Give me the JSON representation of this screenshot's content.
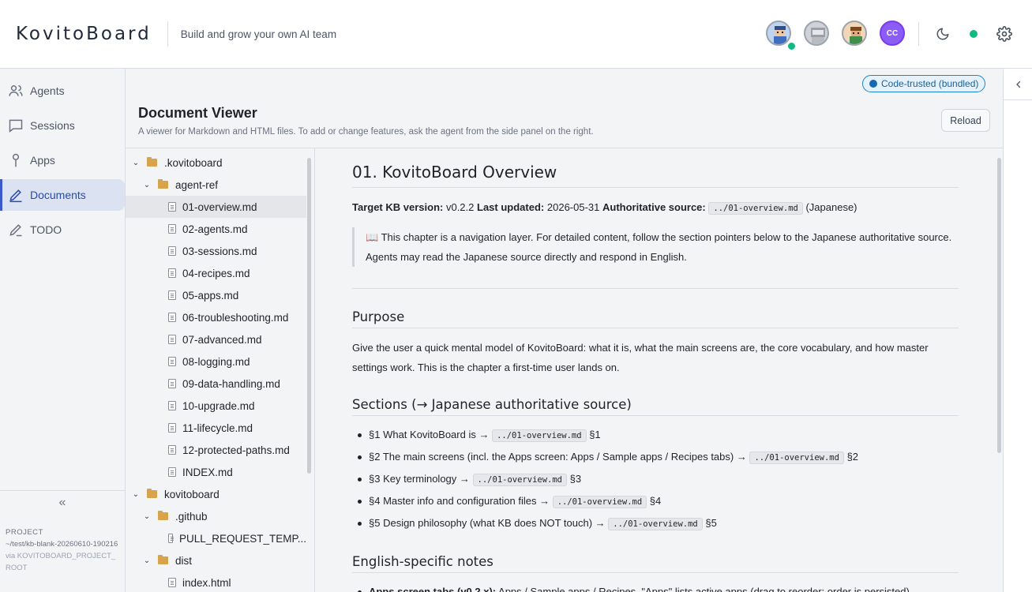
{
  "app": {
    "brand": "KovitoBoard",
    "tagline": "Build and grow your own AI team"
  },
  "header": {
    "avatars": [
      {
        "name": "agent-avatar-1",
        "label": ""
      },
      {
        "name": "agent-avatar-2",
        "label": ""
      },
      {
        "name": "agent-avatar-3",
        "label": ""
      },
      {
        "name": "user-avatar",
        "label": "CC"
      }
    ],
    "icons": [
      "moon-icon",
      "status-dot",
      "gear-icon"
    ]
  },
  "sidebar": {
    "items": [
      {
        "label": "Agents",
        "icon": "users-icon",
        "active": false
      },
      {
        "label": "Sessions",
        "icon": "chat-icon",
        "active": false
      },
      {
        "label": "Apps",
        "icon": "pin-icon",
        "active": false
      },
      {
        "label": "Documents",
        "icon": "pen-icon",
        "active": true
      },
      {
        "label": "TODO",
        "icon": "pencil-icon",
        "active": false
      }
    ],
    "collapse_label": "«",
    "project": {
      "label": "PROJECT",
      "path": "~/test/kb-blank-20260610-190216",
      "via": "via KOVITOBOARD_PROJECT_ROOT"
    }
  },
  "main": {
    "trust_badge": "Code-trusted (bundled)",
    "title": "Document Viewer",
    "description": "A viewer for Markdown and HTML files. To add or change features, ask the agent from the side panel on the right.",
    "reload_label": "Reload"
  },
  "tree": [
    {
      "label": ".kovitoboard",
      "type": "folder",
      "depth": 0,
      "selected": false
    },
    {
      "label": "agent-ref",
      "type": "folder",
      "depth": 1,
      "selected": false
    },
    {
      "label": "01-overview.md",
      "type": "file",
      "depth": 2,
      "selected": true
    },
    {
      "label": "02-agents.md",
      "type": "file",
      "depth": 2,
      "selected": false
    },
    {
      "label": "03-sessions.md",
      "type": "file",
      "depth": 2,
      "selected": false
    },
    {
      "label": "04-recipes.md",
      "type": "file",
      "depth": 2,
      "selected": false
    },
    {
      "label": "05-apps.md",
      "type": "file",
      "depth": 2,
      "selected": false
    },
    {
      "label": "06-troubleshooting.md",
      "type": "file",
      "depth": 2,
      "selected": false
    },
    {
      "label": "07-advanced.md",
      "type": "file",
      "depth": 2,
      "selected": false
    },
    {
      "label": "08-logging.md",
      "type": "file",
      "depth": 2,
      "selected": false
    },
    {
      "label": "09-data-handling.md",
      "type": "file",
      "depth": 2,
      "selected": false
    },
    {
      "label": "10-upgrade.md",
      "type": "file",
      "depth": 2,
      "selected": false
    },
    {
      "label": "11-lifecycle.md",
      "type": "file",
      "depth": 2,
      "selected": false
    },
    {
      "label": "12-protected-paths.md",
      "type": "file",
      "depth": 2,
      "selected": false
    },
    {
      "label": "INDEX.md",
      "type": "file",
      "depth": 2,
      "selected": false
    },
    {
      "label": "kovitoboard",
      "type": "folder",
      "depth": 0,
      "selected": false
    },
    {
      "label": ".github",
      "type": "folder",
      "depth": 1,
      "selected": false
    },
    {
      "label": "PULL_REQUEST_TEMP...",
      "type": "file",
      "depth": 2,
      "selected": false
    },
    {
      "label": "dist",
      "type": "folder",
      "depth": 1,
      "selected": false
    },
    {
      "label": "index.html",
      "type": "file",
      "depth": 2,
      "selected": false
    }
  ],
  "doc": {
    "title": "01. KovitoBoard Overview",
    "meta": {
      "version_label": "Target KB version:",
      "version": "v0.2.2",
      "updated_label": "Last updated:",
      "updated": "2026-05-31",
      "source_label": "Authoritative source:",
      "source_code": "../01-overview.md",
      "source_lang": "(Japanese)"
    },
    "quote_icon": "📖",
    "quote": "This chapter is a navigation layer. For detailed content, follow the section pointers below to the Japanese authoritative source. Agents may read the Japanese source directly and respond in English.",
    "purpose_heading": "Purpose",
    "purpose_text": "Give the user a quick mental model of KovitoBoard: what it is, what the main screens are, the core vocabulary, and how master settings work. This is the chapter a first-time user lands on.",
    "sections_heading": "Sections (→ Japanese authoritative source)",
    "sections": [
      {
        "text": "§1 What KovitoBoard is →",
        "code": "../01-overview.md",
        "suffix": "§1"
      },
      {
        "text": "§2 The main screens (incl. the Apps screen: Apps / Sample apps / Recipes tabs) →",
        "code": "../01-overview.md",
        "suffix": "§2"
      },
      {
        "text": "§3 Key terminology →",
        "code": "../01-overview.md",
        "suffix": "§3"
      },
      {
        "text": "§4 Master info and configuration files →",
        "code": "../01-overview.md",
        "suffix": "§4"
      },
      {
        "text": "§5 Design philosophy (what KB does NOT touch) →",
        "code": "../01-overview.md",
        "suffix": "§5"
      }
    ],
    "english_heading": "English-specific notes",
    "english_notes": [
      {
        "bold": "Apps screen tabs (v0.2.x):",
        "text": " Apps / Sample apps / Recipes. \"Apps\" lists active apps (drag to reorder; order is persisted)."
      }
    ]
  },
  "right_panel": {
    "toggle_icon": "chevron-left-icon"
  }
}
